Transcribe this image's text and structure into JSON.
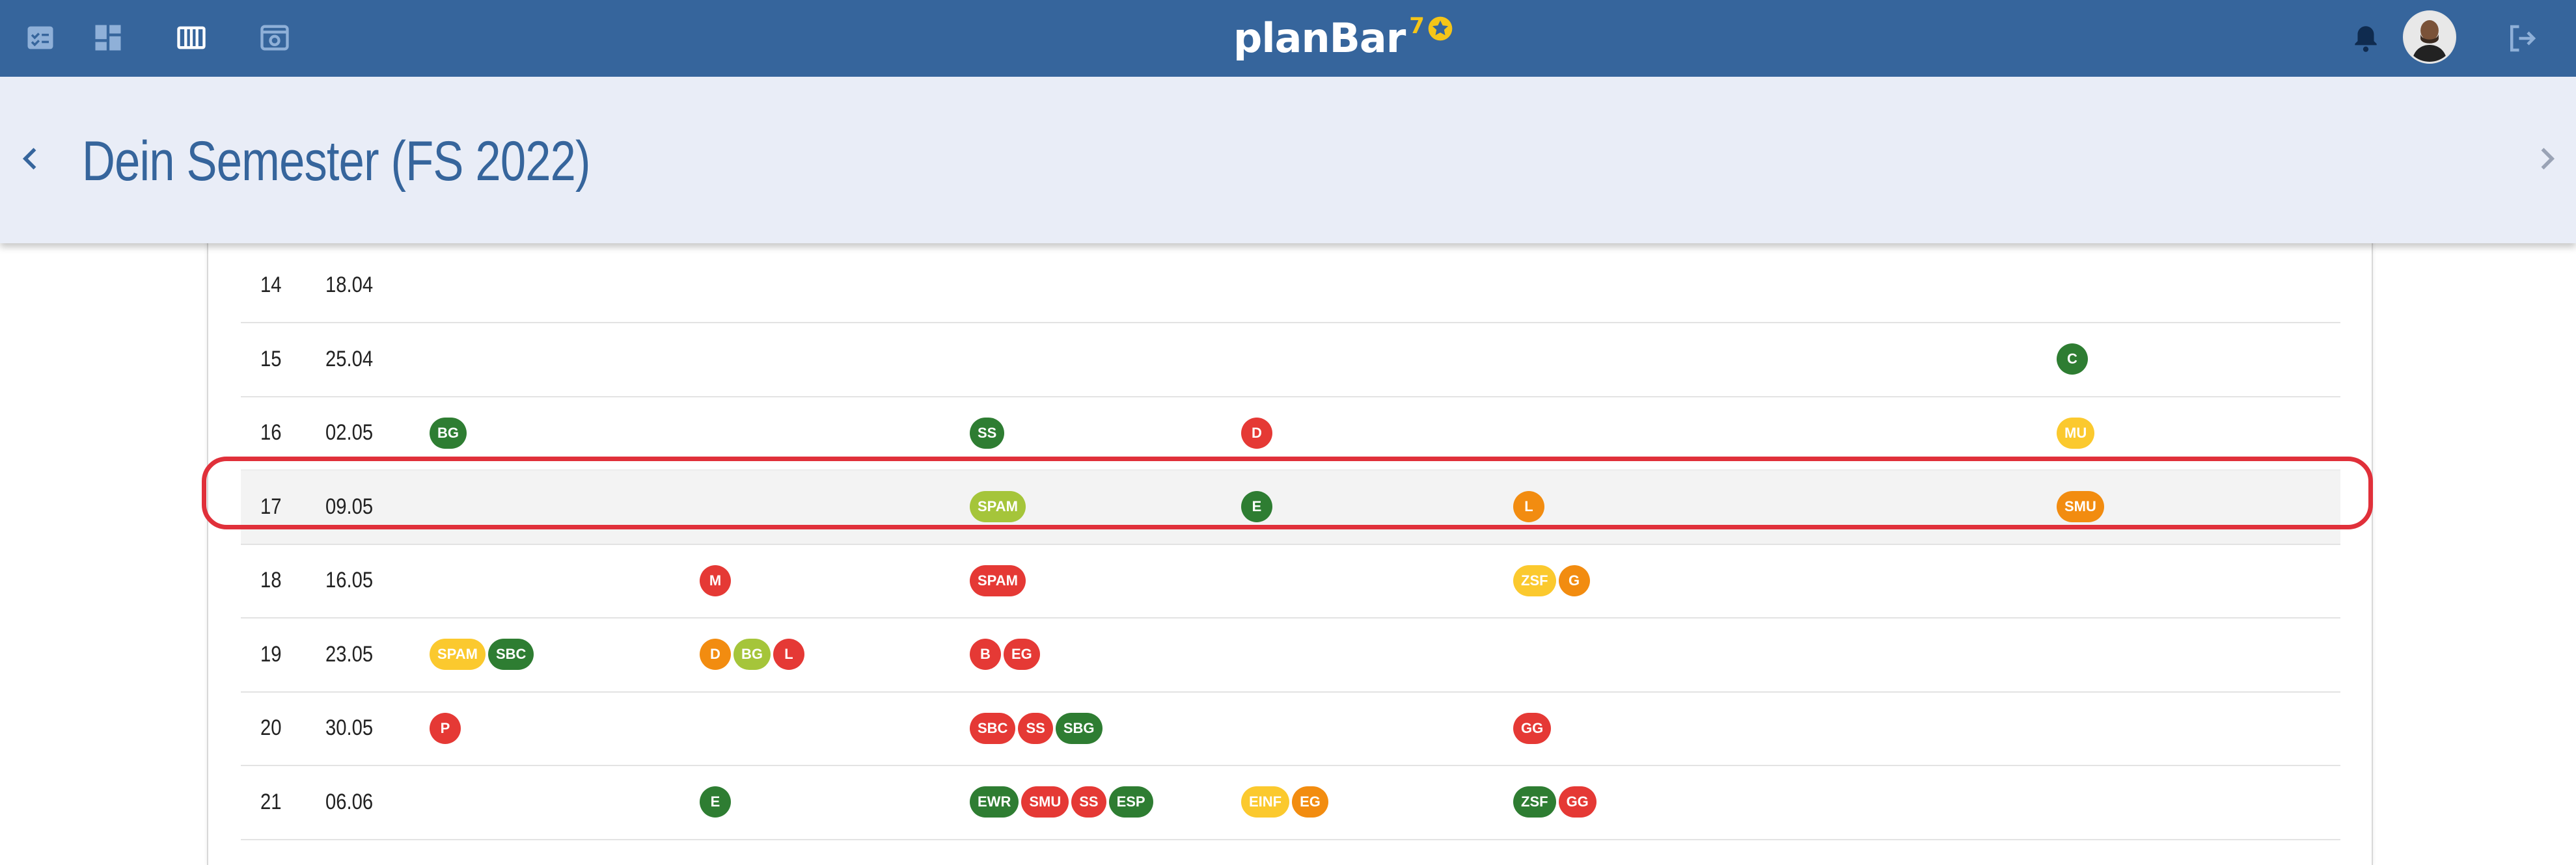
{
  "app": {
    "brand_name": "planBar",
    "brand_superscript": "7"
  },
  "nav_icons": [
    "checklist-icon",
    "dashboard-icon",
    "calendar-columns-icon",
    "screen-icon"
  ],
  "header": {
    "title": "Dein Semester (FS 2022)"
  },
  "colors": {
    "topbar": "#36659c",
    "header_bg": "#e9edf7",
    "green": "#2e7d32",
    "red": "#e53935",
    "orange": "#f28c10",
    "yellow": "#fbc92e",
    "lime": "#a5c53a",
    "highlight": "#e0303a"
  },
  "columns_count": 7,
  "rows": [
    {
      "week": "14",
      "date": "18.04",
      "slots": [
        [],
        [],
        [],
        [],
        [],
        [],
        []
      ]
    },
    {
      "week": "15",
      "date": "25.04",
      "slots": [
        [],
        [],
        [],
        [],
        [],
        [],
        [
          {
            "label": "C",
            "color": "green"
          }
        ]
      ]
    },
    {
      "week": "16",
      "date": "02.05",
      "slots": [
        [
          {
            "label": "BG",
            "color": "green"
          }
        ],
        [],
        [
          {
            "label": "SS",
            "color": "green"
          }
        ],
        [
          {
            "label": "D",
            "color": "red"
          }
        ],
        [],
        [],
        [
          {
            "label": "MU",
            "color": "yellow"
          }
        ]
      ]
    },
    {
      "week": "17",
      "date": "09.05",
      "highlighted": true,
      "slots": [
        [],
        [],
        [
          {
            "label": "SPAM",
            "color": "lime"
          }
        ],
        [
          {
            "label": "E",
            "color": "green"
          }
        ],
        [
          {
            "label": "L",
            "color": "orange"
          }
        ],
        [],
        [
          {
            "label": "SMU",
            "color": "orange"
          }
        ]
      ]
    },
    {
      "week": "18",
      "date": "16.05",
      "slots": [
        [],
        [
          {
            "label": "M",
            "color": "red"
          }
        ],
        [
          {
            "label": "SPAM",
            "color": "red"
          }
        ],
        [],
        [
          {
            "label": "ZSF",
            "color": "yellow"
          },
          {
            "label": "G",
            "color": "orange"
          }
        ],
        [],
        []
      ]
    },
    {
      "week": "19",
      "date": "23.05",
      "slots": [
        [
          {
            "label": "SPAM",
            "color": "yellow"
          },
          {
            "label": "SBC",
            "color": "green"
          }
        ],
        [
          {
            "label": "D",
            "color": "orange"
          },
          {
            "label": "BG",
            "color": "lime"
          },
          {
            "label": "L",
            "color": "red"
          }
        ],
        [
          {
            "label": "B",
            "color": "red"
          },
          {
            "label": "EG",
            "color": "red"
          }
        ],
        [],
        [],
        [],
        []
      ]
    },
    {
      "week": "20",
      "date": "30.05",
      "slots": [
        [
          {
            "label": "P",
            "color": "red"
          }
        ],
        [],
        [
          {
            "label": "SBC",
            "color": "red"
          },
          {
            "label": "SS",
            "color": "red"
          },
          {
            "label": "SBG",
            "color": "green"
          }
        ],
        [],
        [
          {
            "label": "GG",
            "color": "red"
          }
        ],
        [],
        []
      ]
    },
    {
      "week": "21",
      "date": "06.06",
      "slots": [
        [],
        [
          {
            "label": "E",
            "color": "green"
          }
        ],
        [
          {
            "label": "EWR",
            "color": "green"
          },
          {
            "label": "SMU",
            "color": "red"
          },
          {
            "label": "SS",
            "color": "red"
          },
          {
            "label": "ESP",
            "color": "green"
          }
        ],
        [
          {
            "label": "EINF",
            "color": "yellow"
          },
          {
            "label": "EG",
            "color": "orange"
          }
        ],
        [
          {
            "label": "ZSF",
            "color": "green"
          },
          {
            "label": "GG",
            "color": "red"
          }
        ],
        [],
        []
      ]
    }
  ]
}
